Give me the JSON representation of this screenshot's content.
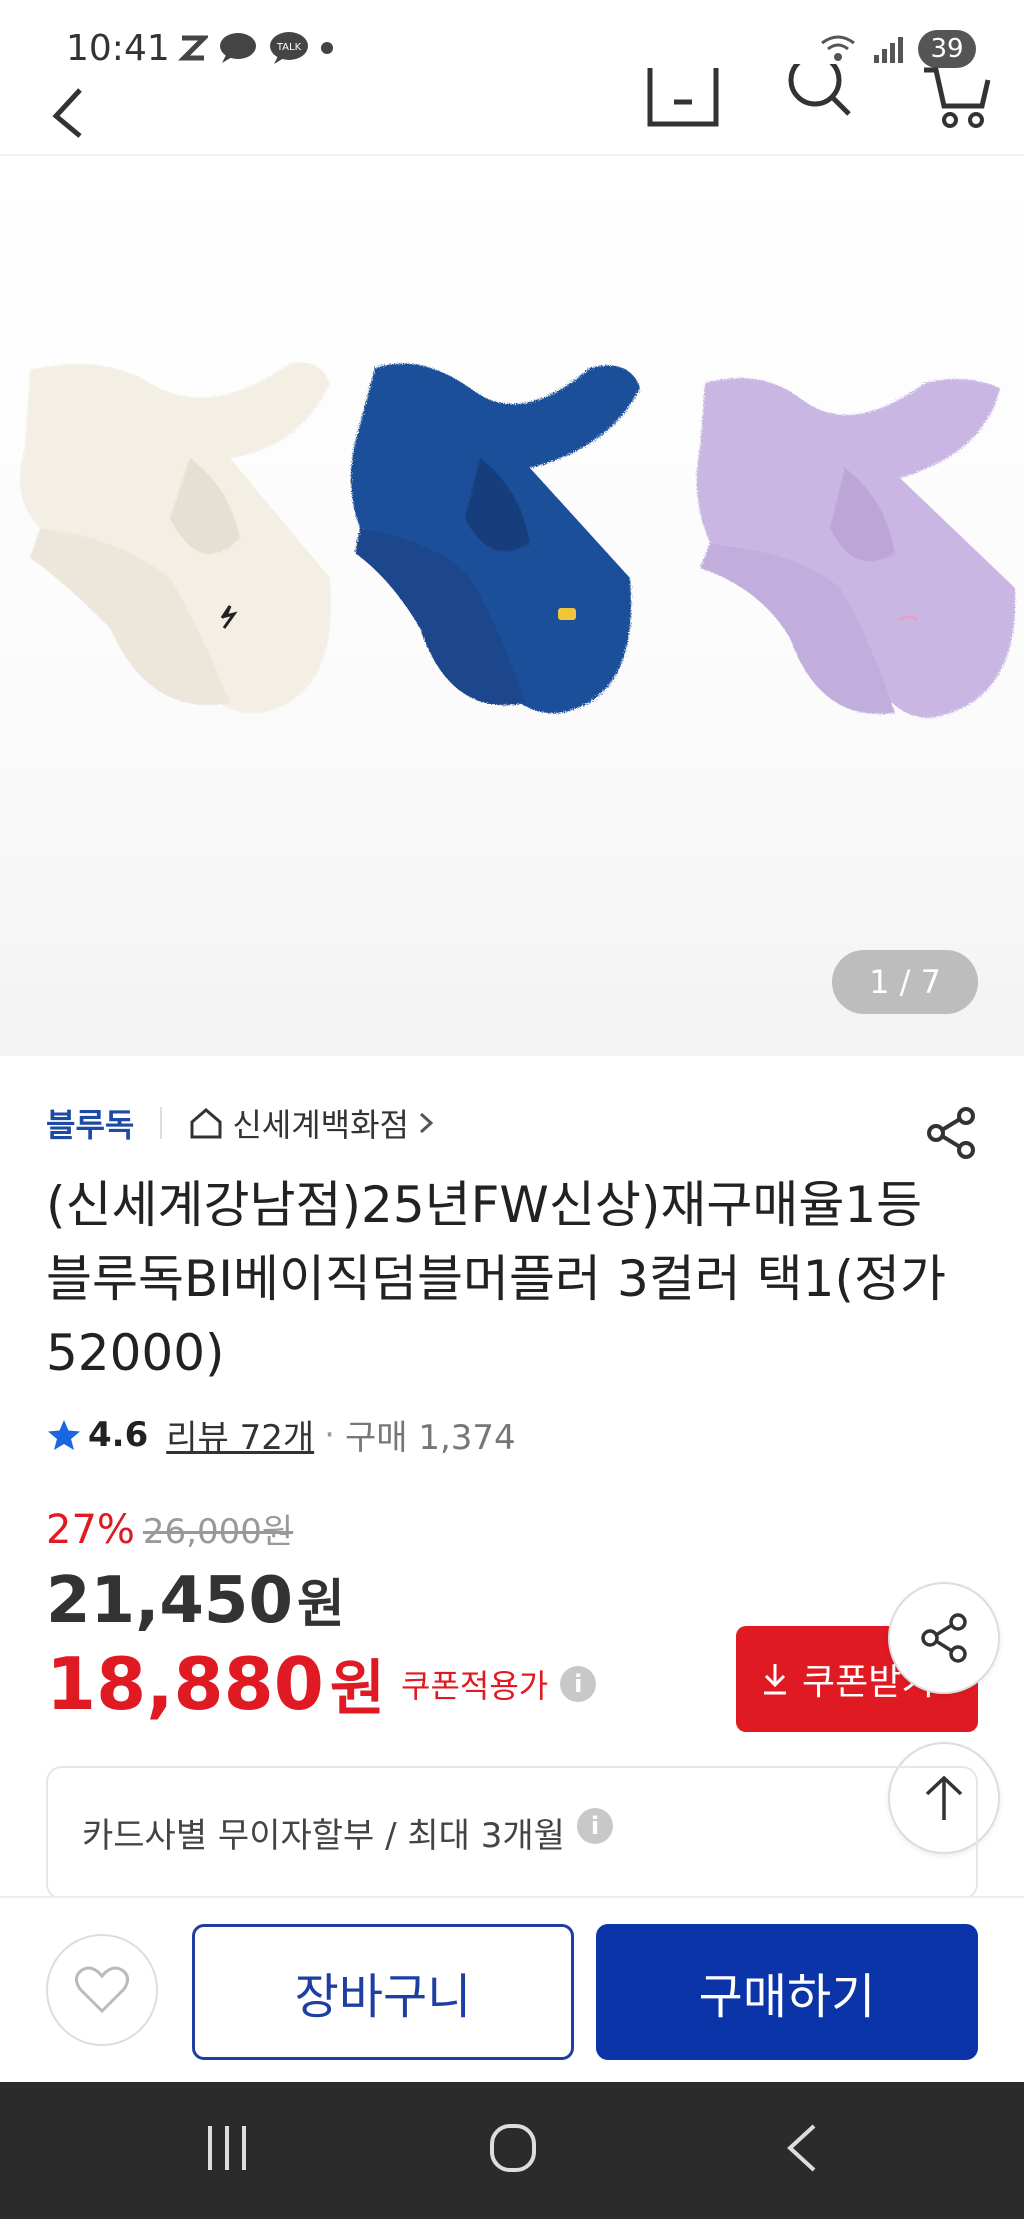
{
  "status_bar": {
    "time": "10:41",
    "battery": "39"
  },
  "gallery": {
    "image_alt": "3 color fleece mufflers: ivory, blue, lavender",
    "pager": "1 / 7",
    "scarf_colors": [
      "#f3efe4",
      "#1e4f9a",
      "#c9b6e2"
    ]
  },
  "product": {
    "brand": "블루독",
    "store": "신세계백화점",
    "title": "(신세계강남점)25년FW신상)재구매율1등블루독BI베이직덤블머플러 3컬러 택1(정가52000)",
    "rating": "4.6",
    "review": "리뷰 72개",
    "purchase": "구매 1,374",
    "discount": "27%",
    "original_price": "26,000원",
    "price": "21,450",
    "price_unit": "원",
    "coupon_price": "18,880",
    "coupon_price_unit": "원",
    "coupon_label": "쿠폰적용가",
    "coupon_button": "쿠폰받기",
    "installment": "카드사별 무이자할부 / 최대 3개월"
  },
  "actions": {
    "cart": "장바구니",
    "buy": "구매하기"
  },
  "colors": {
    "brand_blue": "#1d4aa5",
    "accent_red": "#e01a22",
    "buy_blue": "#0b34a8"
  }
}
